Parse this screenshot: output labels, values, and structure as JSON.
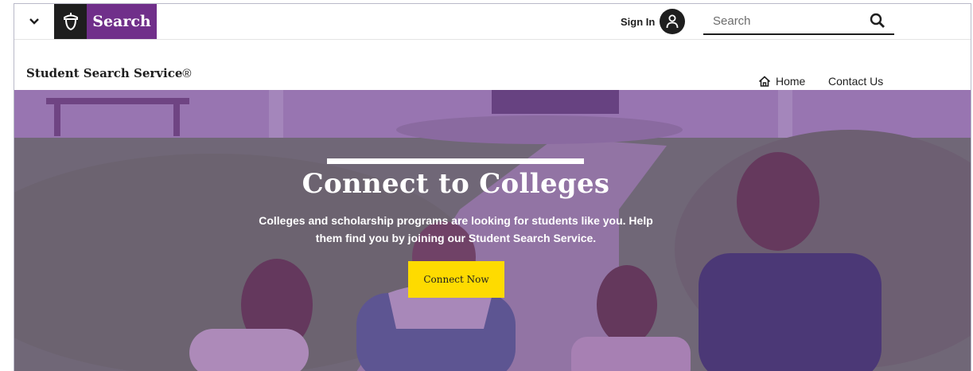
{
  "brand": {
    "label": "Search",
    "accent_color": "#702f8a",
    "logo_icon": "acorn-icon"
  },
  "header": {
    "menu_icon": "chevron-down-icon",
    "sign_in_label": "Sign In",
    "avatar_icon": "user-icon",
    "search": {
      "placeholder": "Search",
      "value": "",
      "button_icon": "search-icon"
    }
  },
  "local_nav": {
    "site_title": "Student Search Service",
    "registered_mark": "®",
    "home_label": "Home",
    "home_icon": "home-icon",
    "contact_label": "Contact Us"
  },
  "hero": {
    "title": "Connect to Colleges",
    "body": "Colleges and scholarship programs are looking for students like you. Help them find you by joining our Student Search Service.",
    "cta_label": "Connect Now",
    "cta_color": "#fedb00",
    "overlay_color": "#7337a0"
  }
}
